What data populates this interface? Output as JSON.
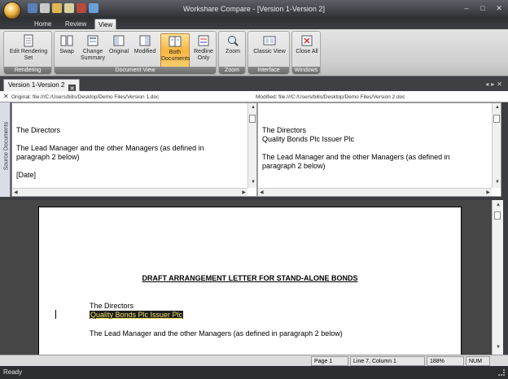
{
  "window": {
    "title": "Workshare Compare - [Version 1-Version 2]",
    "minimize": "–",
    "maximize": "□",
    "close": "✕"
  },
  "quick_access": [
    "save-icon",
    "print-icon",
    "open-icon",
    "email-icon",
    "compare-icon",
    "undo-icon"
  ],
  "tabs": [
    {
      "label": "Home"
    },
    {
      "label": "Review"
    },
    {
      "label": "View",
      "active": true
    }
  ],
  "ribbon": {
    "groups": [
      {
        "label": "Rendering",
        "buttons": [
          {
            "label": "Edit Rendering Set",
            "icon": "document-icon"
          }
        ]
      },
      {
        "label": "Document View",
        "buttons": [
          {
            "label": "Swap",
            "icon": "swap-icon"
          },
          {
            "label": "Change Summary",
            "icon": "summary-icon"
          },
          {
            "label": "Original",
            "icon": "original-doc-icon"
          },
          {
            "label": "Modified",
            "icon": "modified-doc-icon"
          },
          {
            "label": "Both Documents",
            "icon": "both-docs-icon",
            "active": true
          },
          {
            "label": "Redline Only",
            "icon": "redline-icon"
          }
        ]
      },
      {
        "label": "Zoom",
        "buttons": [
          {
            "label": "Zoom",
            "icon": "magnifier-icon"
          }
        ]
      },
      {
        "label": "Interface",
        "buttons": [
          {
            "label": "Classic View",
            "icon": "classic-view-icon"
          }
        ]
      },
      {
        "label": "Windows",
        "buttons": [
          {
            "label": "Close All",
            "icon": "close-all-icon"
          }
        ]
      }
    ]
  },
  "doc_tab": {
    "label": "Version 1-Version 2",
    "close": "✕"
  },
  "source": {
    "side_label": "Source Documents",
    "original_path": "Original: file:///C:/Users/bills/Desktop/Demo Files/Version 1.doc",
    "modified_path": "Modified: file:///C:/Users/bills/Desktop/Demo Files/Version 2.doc",
    "original_lines": [
      "The Directors",
      "",
      "The Lead Manager and the other Managers (as defined in",
      "paragraph 2 below)",
      "",
      "[Date]"
    ],
    "modified_lines": [
      "The Directors",
      "Quality Bonds Plc Issuer Plc",
      "",
      "The Lead Manager and the other Managers (as defined in",
      "paragraph 2 below)"
    ]
  },
  "document": {
    "heading": "DRAFT ARRANGEMENT LETTER FOR STAND-ALONE BONDS",
    "line1": "The Directors",
    "inserted": "Quality Bonds Plc Issuer Plc",
    "line3": "The Lead Manager and the other Managers (as defined in paragraph 2 below)"
  },
  "status": {
    "page": "Page 1",
    "position": "Line 7,   Column 1",
    "zoom": "188%",
    "num": "NUM",
    "app": "Ready"
  },
  "colors": {
    "accent": "#f7b640",
    "insertion_bg": "#1d1d1d",
    "insertion_text": "#f0e060"
  }
}
